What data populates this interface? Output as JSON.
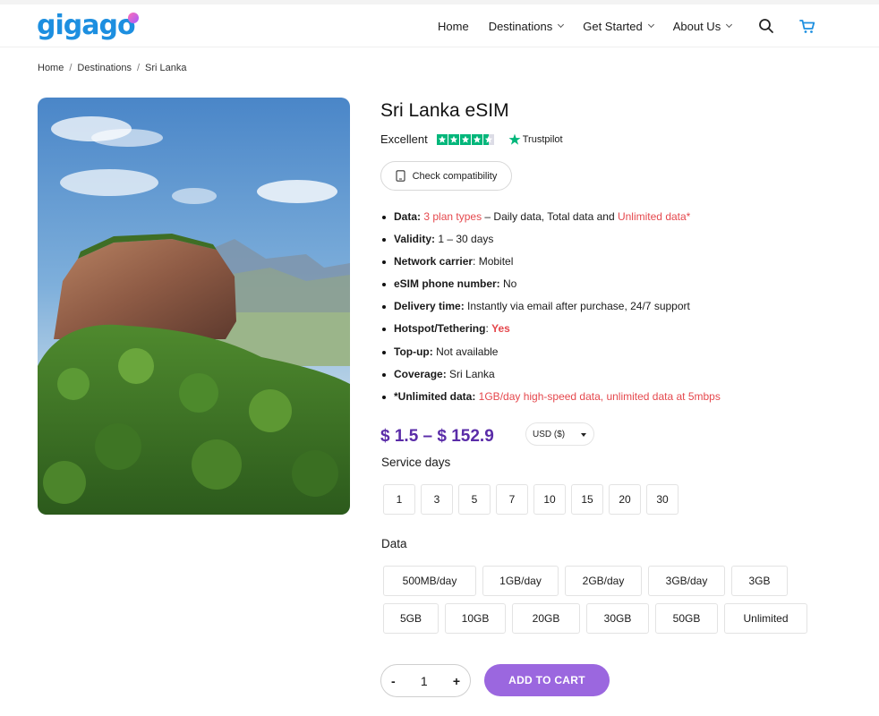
{
  "brand": {
    "logo_text": "gigago"
  },
  "nav": {
    "items": [
      {
        "label": "Home"
      },
      {
        "label": "Destinations"
      },
      {
        "label": "Get Started"
      },
      {
        "label": "About Us"
      }
    ]
  },
  "breadcrumb": [
    "Home",
    "Destinations",
    "Sri Lanka"
  ],
  "product": {
    "title": "Sri Lanka eSIM",
    "rating_label": "Excellent",
    "trustpilot_label": "Trustpilot",
    "compat_label": "Check compatibility",
    "specs": {
      "data_label": "Data:",
      "data_plan": "3 plan types",
      "data_mid": " – Daily data, Total data and ",
      "data_unlimited": "Unlimited data*",
      "validity_label": "Validity:",
      "validity_value": " 1 – 30 days",
      "carrier_label": "Network carrier",
      "carrier_value": ": Mobitel",
      "phone_label": "eSIM phone number:",
      "phone_value": " No",
      "delivery_label": "Delivery time:",
      "delivery_value": " Instantly via email after purchase, 24/7 support",
      "hotspot_label": "Hotspot/Tethering",
      "hotspot_sep": ": ",
      "hotspot_value": "Yes",
      "topup_label": "Top-up:",
      "topup_value": " Not available",
      "coverage_label": "Coverage:",
      "coverage_value": " Sri Lanka",
      "unl_label": "*Unlimited data:",
      "unl_value": " 1GB/day high-speed data, unlimited data at 5mbps"
    },
    "price": "$ 1.5 – $ 152.9",
    "currency": "USD ($)",
    "service_days_label": "Service days",
    "service_days": [
      "1",
      "3",
      "5",
      "7",
      "10",
      "15",
      "20",
      "30"
    ],
    "data_label": "Data",
    "data_options_row1": [
      "500MB/day",
      "1GB/day",
      "2GB/day",
      "3GB/day",
      "3GB"
    ],
    "data_options_row2": [
      "5GB",
      "10GB",
      "20GB",
      "30GB",
      "50GB",
      "Unlimited"
    ],
    "quantity": "1",
    "qty_minus": "-",
    "qty_plus": "+",
    "add_to_cart": "ADD TO CART"
  },
  "colors": {
    "brand_blue": "#1d8fe0",
    "price_purple": "#5a2ca8",
    "accent_red": "#e5484d",
    "cart_button": "#9b67df",
    "trustpilot_green": "#00b67a"
  },
  "rating_stars": 4.5
}
